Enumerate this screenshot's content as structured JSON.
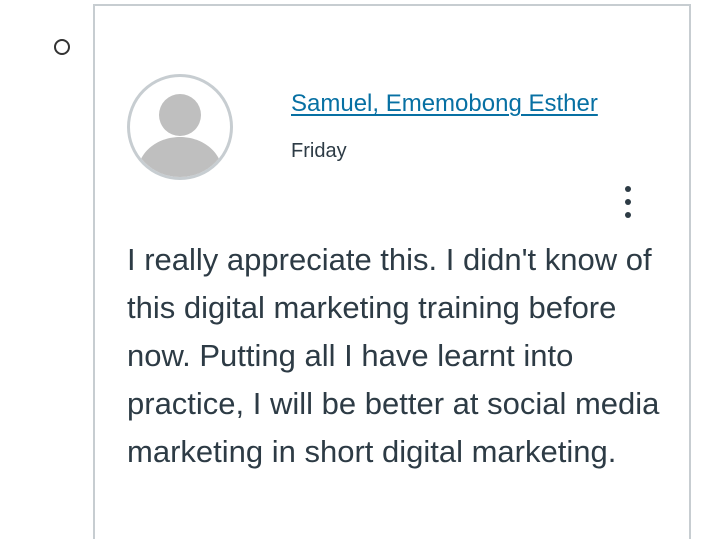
{
  "entry": {
    "author_name": "Samuel, Ememobong Esther",
    "posted_date": "Friday",
    "message": "I really appreciate this. I didn't know of this digital marketing training before now. Putting all I have learnt into practice, I will be better at social media marketing in short digital marketing.",
    "avatar_icon": "default-user-avatar-icon",
    "options_icon": "kebab-menu-icon"
  },
  "colors": {
    "link": "#0770a3",
    "text": "#2d3b45",
    "border": "#c7cdd1",
    "avatar_fill": "#bfbfbf"
  }
}
